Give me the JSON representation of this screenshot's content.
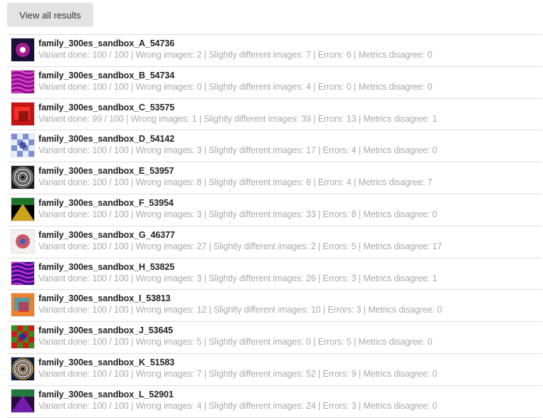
{
  "toolbar": {
    "view_all_label": "View all results"
  },
  "results": [
    {
      "title": "family_300es_sandbox_A_54736",
      "stats": "Variant done: 100 / 100 | Wrong images: 2 | Slightly different images: 7 | Errors: 6 | Metrics disagree: 0",
      "thumb_colors": [
        "#1a0f3a",
        "#c01fa0",
        "#ffffff"
      ]
    },
    {
      "title": "family_300es_sandbox_B_54734",
      "stats": "Variant done: 100 / 100 | Wrong images: 0 | Slightly different images: 4 | Errors: 0 | Metrics disagree: 0",
      "thumb_colors": [
        "#8a0f8f",
        "#e040c8",
        "#ff66ff"
      ]
    },
    {
      "title": "family_300es_sandbox_C_53575",
      "stats": "Variant done: 99 / 100 | Wrong images: 1 | Slightly different images: 39 | Errors: 13 | Metrics disagree: 1",
      "thumb_colors": [
        "#c81414",
        "#ff3a2a",
        "#700808"
      ]
    },
    {
      "title": "family_300es_sandbox_D_54142",
      "stats": "Variant done: 100 / 100 | Wrong images: 3 | Slightly different images: 17 | Errors: 4 | Metrics disagree: 0",
      "thumb_colors": [
        "#e8eef8",
        "#6a7fd0",
        "#2a3a90"
      ]
    },
    {
      "title": "family_300es_sandbox_E_53957",
      "stats": "Variant done: 100 / 100 | Wrong images: 8 | Slightly different images: 6 | Errors: 4 | Metrics disagree: 7",
      "thumb_colors": [
        "#1c1c1c",
        "#8a8a8a",
        "#f0f0f0"
      ]
    },
    {
      "title": "family_300es_sandbox_F_53954",
      "stats": "Variant done: 100 / 100 | Wrong images: 3 | Slightly different images: 33 | Errors: 8 | Metrics disagree: 0",
      "thumb_colors": [
        "#000000",
        "#f0c020",
        "#30c040"
      ]
    },
    {
      "title": "family_300es_sandbox_G_46377",
      "stats": "Variant done: 100 / 100 | Wrong images: 27 | Slightly different images: 2 | Errors: 5 | Metrics disagree: 17",
      "thumb_colors": [
        "#f4f0f0",
        "#c04050",
        "#4060c0"
      ]
    },
    {
      "title": "family_300es_sandbox_H_53825",
      "stats": "Variant done: 100 / 100 | Wrong images: 3 | Slightly different images: 26 | Errors: 3 | Metrics disagree: 1",
      "thumb_colors": [
        "#3a0a8a",
        "#c030d0",
        "#ff50ff"
      ]
    },
    {
      "title": "family_300es_sandbox_I_53813",
      "stats": "Variant done: 100 / 100 | Wrong images: 12 | Slightly different images: 10 | Errors: 3 | Metrics disagree: 0",
      "thumb_colors": [
        "#f08030",
        "#30a0c0",
        "#d02040"
      ]
    },
    {
      "title": "family_300es_sandbox_J_53645",
      "stats": "Variant done: 100 / 100 | Wrong images: 5 | Slightly different images: 0 | Errors: 5 | Metrics disagree: 0",
      "thumb_colors": [
        "#d01818",
        "#20a020",
        "#2020c0"
      ]
    },
    {
      "title": "family_300es_sandbox_K_51583",
      "stats": "Variant done: 100 / 100 | Wrong images: 7 | Slightly different images: 52 | Errors: 9 | Metrics disagree: 0",
      "thumb_colors": [
        "#102040",
        "#e0a040",
        "#f0f0ff"
      ]
    },
    {
      "title": "family_300es_sandbox_L_52901",
      "stats": "Variant done: 100 / 100 | Wrong images: 4 | Slightly different images: 24 | Errors: 3 | Metrics disagree: 0",
      "thumb_colors": [
        "#2a0a40",
        "#8020c0",
        "#20c040"
      ]
    }
  ]
}
